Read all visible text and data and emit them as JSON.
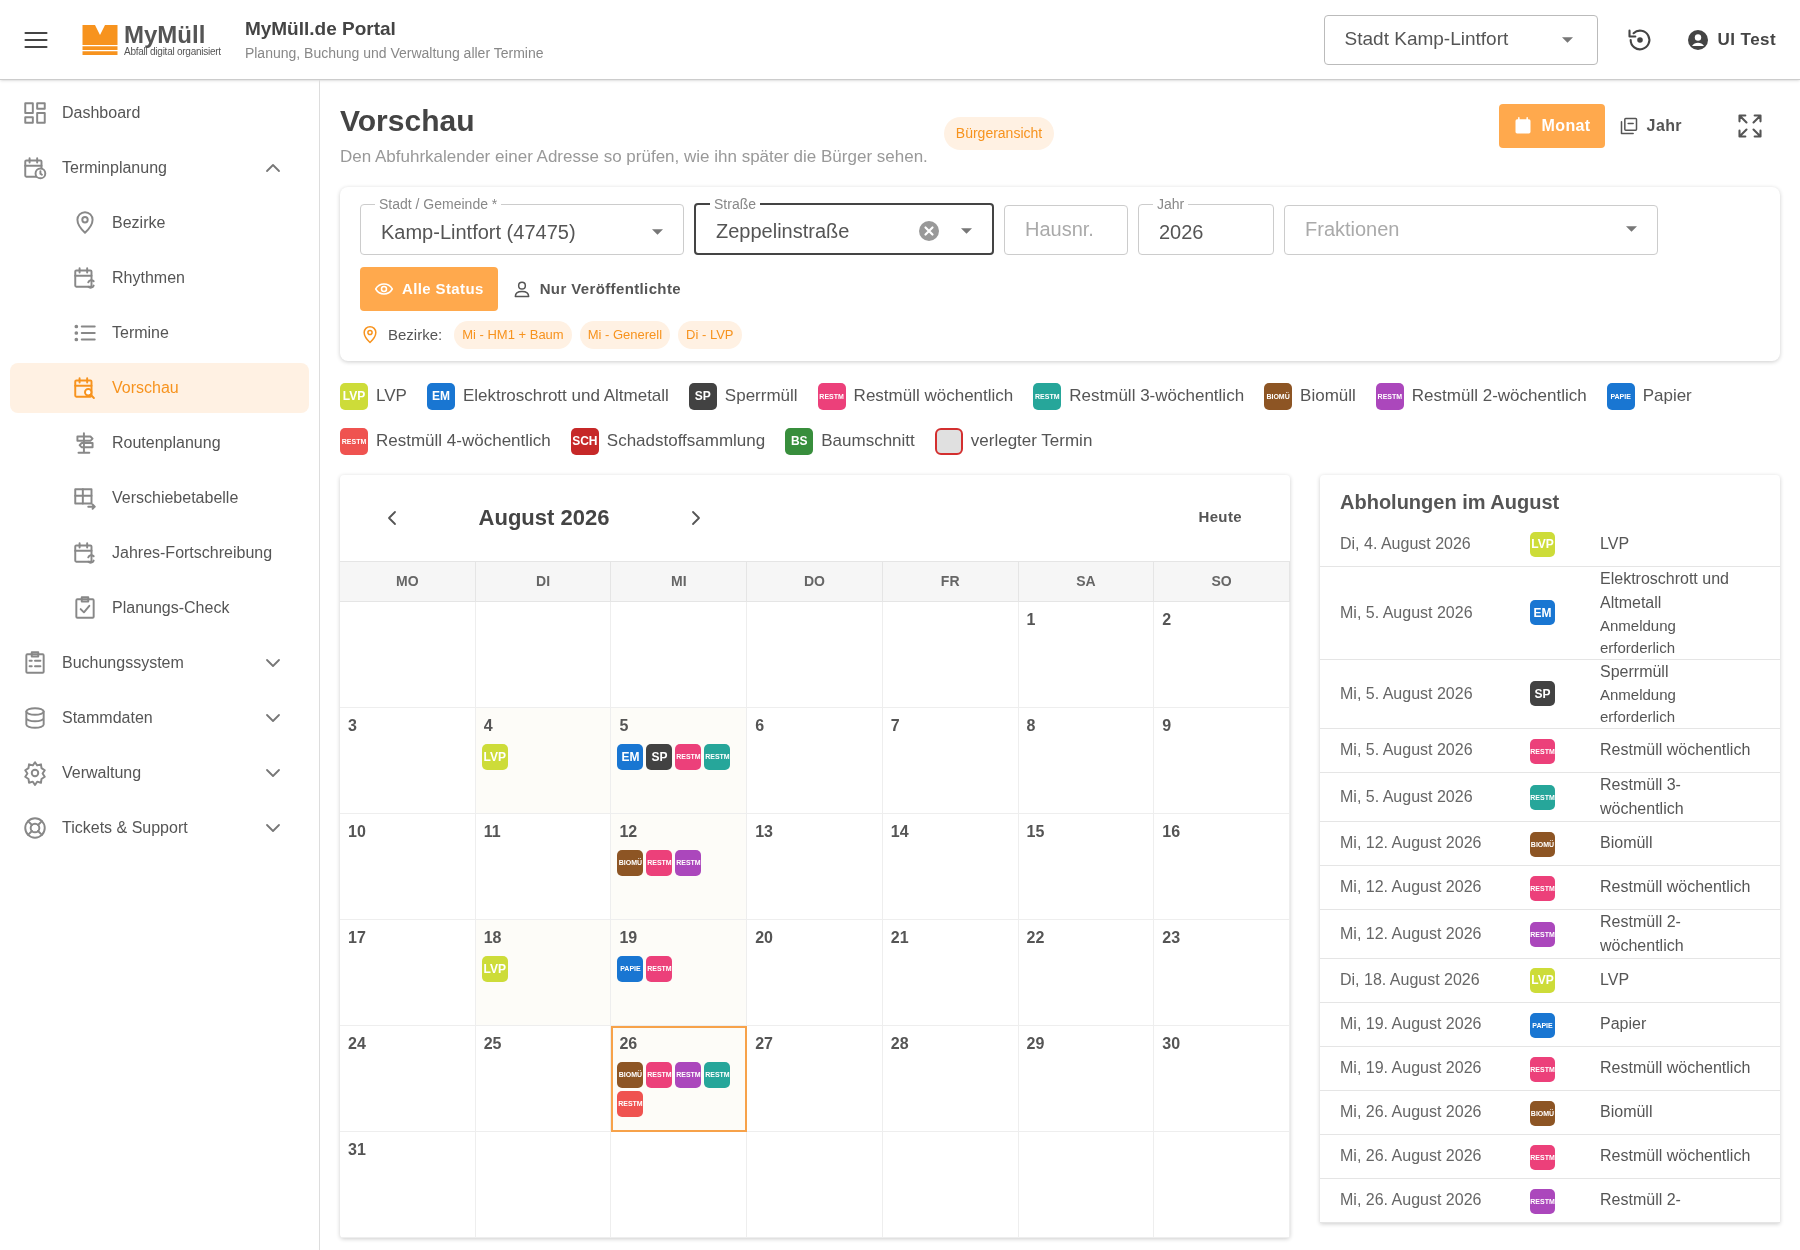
{
  "header": {
    "logo": {
      "name": "MyMüll",
      "tagline": "Abfall digital organisiert"
    },
    "title": "MyMüll.de Portal",
    "subtitle": "Planung, Buchung und Verwaltung aller Termine",
    "city_select": {
      "value": "Stadt Kamp-Lintfort"
    },
    "user": "UI Test"
  },
  "sidebar": {
    "items": [
      {
        "label": "Dashboard",
        "selected": false
      },
      {
        "label": "Terminplanung",
        "selected": false,
        "expanded": true,
        "children": [
          {
            "label": "Bezirke",
            "selected": false
          },
          {
            "label": "Rhythmen",
            "selected": false
          },
          {
            "label": "Termine",
            "selected": false
          },
          {
            "label": "Vorschau",
            "selected": true
          },
          {
            "label": "Routenplanung",
            "selected": false
          },
          {
            "label": "Verschiebetabelle",
            "selected": false
          },
          {
            "label": "Jahres-Fortschreibung",
            "selected": false
          },
          {
            "label": "Planungs-Check",
            "selected": false
          }
        ]
      },
      {
        "label": "Buchungssystem",
        "selected": false,
        "expanded": false
      },
      {
        "label": "Stammdaten",
        "selected": false,
        "expanded": false
      },
      {
        "label": "Verwaltung",
        "selected": false,
        "expanded": false
      },
      {
        "label": "Tickets & Support",
        "selected": false,
        "expanded": false
      }
    ]
  },
  "page": {
    "title": "Vorschau",
    "subtitle": "Den Abfuhrkalender einer Adresse so prüfen, wie ihn später die Bürger sehen.",
    "badge": "Bürgeransicht",
    "views": [
      {
        "label": "Monat",
        "selected": true
      },
      {
        "label": "Jahr",
        "selected": false
      }
    ]
  },
  "filters": {
    "fields": [
      {
        "kind": "select",
        "label": "Stadt / Gemeinde *",
        "value": "Kamp-Lintfort (47475)",
        "focused": false,
        "clearable": false
      },
      {
        "kind": "select",
        "label": "Straße",
        "value": "Zeppelinstraße",
        "focused": true,
        "clearable": true
      },
      {
        "kind": "text",
        "placeholder": "Hausnr.",
        "focused": false,
        "clearable": false
      },
      {
        "kind": "text",
        "label": "Jahr",
        "value": "2026",
        "focused": false,
        "clearable": false
      },
      {
        "kind": "select",
        "placeholder": "Fraktionen",
        "focused": false,
        "clearable": false
      }
    ],
    "status": [
      {
        "label": "Alle Status",
        "selected": true
      },
      {
        "label": "Nur Veröffentlichte",
        "selected": false
      }
    ],
    "districts_label": "Bezirke:",
    "districts": [
      "Mi - HM1 + Baum",
      "Mi - Generell",
      "Di - LVP"
    ]
  },
  "legend": [
    {
      "kind": "badge",
      "code": "LVP",
      "color": "#cddc39",
      "label": "LVP"
    },
    {
      "kind": "badge",
      "code": "EM",
      "color": "#1976d2",
      "label": "Elektroschrott und Altmetall"
    },
    {
      "kind": "badge",
      "code": "SP",
      "color": "#424242",
      "label": "Sperrmüll"
    },
    {
      "kind": "badge",
      "code": "RESTM",
      "color": "#ec407a",
      "label": "Restmüll wöchentlich"
    },
    {
      "kind": "badge",
      "code": "RESTM",
      "color": "#26a69a",
      "label": "Restmüll 3-wöchentlich"
    },
    {
      "kind": "badge",
      "code": "BIOMÜ",
      "color": "#8d5524",
      "label": "Biomüll"
    },
    {
      "kind": "badge",
      "code": "RESTM",
      "color": "#ab47bc",
      "label": "Restmüll 2-wöchentlich"
    },
    {
      "kind": "badge",
      "code": "PAPIE",
      "color": "#1976d2",
      "label": "Papier"
    },
    {
      "kind": "badge",
      "code": "RESTM",
      "color": "#ef5350",
      "label": "Restmüll 4-wöchentlich"
    },
    {
      "kind": "badge",
      "code": "SCH",
      "color": "#c62828",
      "label": "Schadstoffsammlung"
    },
    {
      "kind": "badge",
      "code": "BS",
      "color": "#388e3c",
      "label": "Baumschnitt"
    },
    {
      "kind": "moved",
      "label": "verlegter Termin"
    }
  ],
  "calendar": {
    "month": "August 2026",
    "today": "Heute",
    "weekdays": [
      "MO",
      "DI",
      "MI",
      "DO",
      "FR",
      "SA",
      "SO"
    ],
    "weeks": [
      [
        {
          "day": "1",
          "selected": false
        },
        {
          "day": "2",
          "selected": false
        }
      ],
      [
        {
          "day": "3",
          "selected": false
        },
        {
          "day": "4",
          "selected": false,
          "events": [
            {
              "code": "LVP",
              "color": "#cddc39"
            }
          ]
        },
        {
          "day": "5",
          "selected": false,
          "events": [
            {
              "code": "EM",
              "color": "#1976d2"
            },
            {
              "code": "SP",
              "color": "#424242"
            },
            {
              "code": "RESTM",
              "color": "#ec407a"
            },
            {
              "code": "RESTM",
              "color": "#26a69a"
            }
          ]
        },
        {
          "day": "6",
          "selected": false
        },
        {
          "day": "7",
          "selected": false
        },
        {
          "day": "8",
          "selected": false
        },
        {
          "day": "9",
          "selected": false
        }
      ],
      [
        {
          "day": "10",
          "selected": false
        },
        {
          "day": "11",
          "selected": false
        },
        {
          "day": "12",
          "selected": false,
          "events": [
            {
              "code": "BIOMÜ",
              "color": "#8d5524"
            },
            {
              "code": "RESTM",
              "color": "#ec407a"
            },
            {
              "code": "RESTM",
              "color": "#ab47bc"
            }
          ]
        },
        {
          "day": "13",
          "selected": false
        },
        {
          "day": "14",
          "selected": false
        },
        {
          "day": "15",
          "selected": false
        },
        {
          "day": "16",
          "selected": false
        }
      ],
      [
        {
          "day": "17",
          "selected": false
        },
        {
          "day": "18",
          "selected": false,
          "events": [
            {
              "code": "LVP",
              "color": "#cddc39"
            }
          ]
        },
        {
          "day": "19",
          "selected": false,
          "events": [
            {
              "code": "PAPIE",
              "color": "#1976d2"
            },
            {
              "code": "RESTM",
              "color": "#ec407a"
            }
          ]
        },
        {
          "day": "20",
          "selected": false
        },
        {
          "day": "21",
          "selected": false
        },
        {
          "day": "22",
          "selected": false
        },
        {
          "day": "23",
          "selected": false
        }
      ],
      [
        {
          "day": "24",
          "selected": false
        },
        {
          "day": "25",
          "selected": false
        },
        {
          "day": "26",
          "selected": true,
          "events": [
            {
              "code": "BIOMÜ",
              "color": "#8d5524"
            },
            {
              "code": "RESTM",
              "color": "#ec407a"
            },
            {
              "code": "RESTM",
              "color": "#ab47bc"
            },
            {
              "code": "RESTM",
              "color": "#26a69a"
            },
            {
              "code": "RESTM",
              "color": "#ef5350"
            }
          ]
        },
        {
          "day": "27",
          "selected": false
        },
        {
          "day": "28",
          "selected": false
        },
        {
          "day": "29",
          "selected": false
        },
        {
          "day": "30",
          "selected": false
        }
      ],
      [
        {
          "day": "31",
          "selected": false
        }
      ]
    ]
  },
  "pickups": {
    "title": "Abholungen im August",
    "items": [
      {
        "date": "Di, 4. August 2026",
        "code": "LVP",
        "color": "#cddc39",
        "label": "LVP"
      },
      {
        "date": "Mi, 5. August 2026",
        "code": "EM",
        "color": "#1976d2",
        "label": "Elektroschrott und Altmetall",
        "note": "Anmeldung erforderlich"
      },
      {
        "date": "Mi, 5. August 2026",
        "code": "SP",
        "color": "#424242",
        "label": "Sperrmüll",
        "note": "Anmeldung erforderlich"
      },
      {
        "date": "Mi, 5. August 2026",
        "code": "RESTM",
        "color": "#ec407a",
        "label": "Restmüll wöchentlich"
      },
      {
        "date": "Mi, 5. August 2026",
        "code": "RESTM",
        "color": "#26a69a",
        "label": "Restmüll 3-wöchentlich"
      },
      {
        "date": "Mi, 12. August 2026",
        "code": "BIOMÜ",
        "color": "#8d5524",
        "label": "Biomüll"
      },
      {
        "date": "Mi, 12. August 2026",
        "code": "RESTM",
        "color": "#ec407a",
        "label": "Restmüll wöchentlich"
      },
      {
        "date": "Mi, 12. August 2026",
        "code": "RESTM",
        "color": "#ab47bc",
        "label": "Restmüll 2-wöchentlich"
      },
      {
        "date": "Di, 18. August 2026",
        "code": "LVP",
        "color": "#cddc39",
        "label": "LVP"
      },
      {
        "date": "Mi, 19. August 2026",
        "code": "PAPIE",
        "color": "#1976d2",
        "label": "Papier"
      },
      {
        "date": "Mi, 19. August 2026",
        "code": "RESTM",
        "color": "#ec407a",
        "label": "Restmüll wöchentlich"
      },
      {
        "date": "Mi, 26. August 2026",
        "code": "BIOMÜ",
        "color": "#8d5524",
        "label": "Biomüll"
      },
      {
        "date": "Mi, 26. August 2026",
        "code": "RESTM",
        "color": "#ec407a",
        "label": "Restmüll wöchentlich"
      },
      {
        "date": "Mi, 26. August 2026",
        "code": "RESTM",
        "color": "#ab47bc",
        "label": "Restmüll 2-"
      }
    ]
  }
}
